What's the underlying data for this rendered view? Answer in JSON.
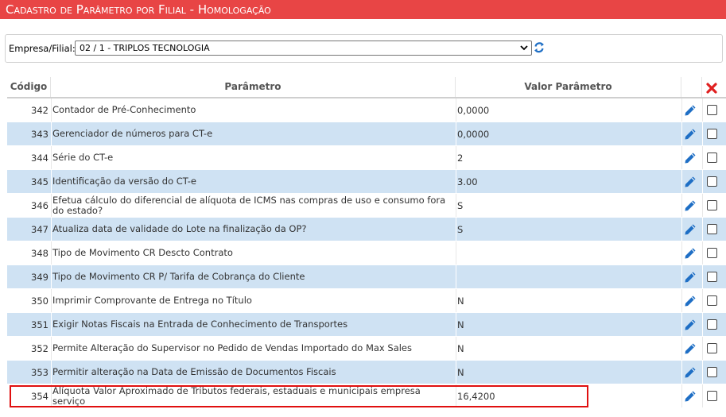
{
  "page": {
    "title": "Cadastro de Parâmetro por Filial   - Homologação"
  },
  "filter": {
    "label": "Empresa/Filial:",
    "selected": "02 / 1 - TRIPLOS TECNOLOGIA",
    "refresh_icon": "refresh-icon"
  },
  "table": {
    "headers": {
      "code": "Código",
      "param": "Parâmetro",
      "value": "Valor Parâmetro"
    },
    "header_delete_icon": "delete-x-icon",
    "rows": [
      {
        "code": "342",
        "param": "Contador de Pré-Conhecimento",
        "value": "0,0000"
      },
      {
        "code": "343",
        "param": "Gerenciador de números para CT-e",
        "value": "0,0000"
      },
      {
        "code": "344",
        "param": "Série do CT-e",
        "value": "2"
      },
      {
        "code": "345",
        "param": "Identificação da versão do CT-e",
        "value": "3.00"
      },
      {
        "code": "346",
        "param": "Efetua cálculo do diferencial de alíquota de ICMS nas compras de uso e consumo fora do estado?",
        "value": "S"
      },
      {
        "code": "347",
        "param": "Atualiza data de validade do Lote na finalização da OP?",
        "value": "S"
      },
      {
        "code": "348",
        "param": "Tipo de Movimento CR Descto Contrato",
        "value": ""
      },
      {
        "code": "349",
        "param": "Tipo de Movimento CR P/ Tarifa de Cobrança do Cliente",
        "value": ""
      },
      {
        "code": "350",
        "param": "Imprimir Comprovante de Entrega no Título",
        "value": "N"
      },
      {
        "code": "351",
        "param": "Exigir Notas Fiscais na Entrada de Conhecimento de Transportes",
        "value": "N"
      },
      {
        "code": "352",
        "param": "Permite Alteração do Supervisor no Pedido de Vendas Importado do Max Sales",
        "value": "N"
      },
      {
        "code": "353",
        "param": "Permitir alteração na Data de Emissão de Documentos Fiscais",
        "value": "N"
      },
      {
        "code": "354",
        "param": "Alíquota Valor Aproximado de Tributos federais, estaduais e municipais empresa serviço",
        "value": "16,4200"
      }
    ],
    "row_edit_icon": "pencil-icon"
  },
  "colors": {
    "title_bg": "#e84545",
    "row_alt": "#cfe2f3",
    "pencil": "#1f6fc5",
    "highlight": "#e01010",
    "delete": "#e02020"
  }
}
